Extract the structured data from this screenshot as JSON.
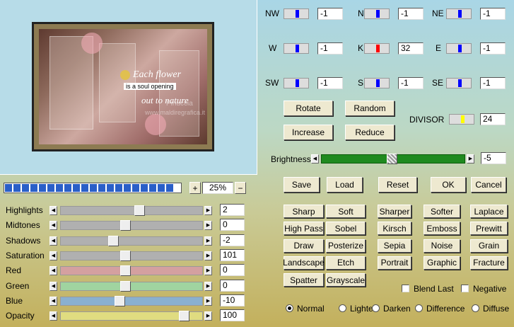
{
  "preview": {
    "text_line1": "Each flower",
    "text_line2": "is a soul opening",
    "text_line3": "out to nature",
    "watermark_line1": "Pinuccia",
    "watermark_line2": "www.maldiregrafica.it"
  },
  "zoom": {
    "plus": "+",
    "minus": "−",
    "value": "25%",
    "segments": 20
  },
  "grid": [
    {
      "label": "NW",
      "value": "-1",
      "color": "#0000ff"
    },
    {
      "label": "N",
      "value": "-1",
      "color": "#0000ff"
    },
    {
      "label": "NE",
      "value": "-1",
      "color": "#0000ff"
    },
    {
      "label": "W",
      "value": "-1",
      "color": "#0000ff"
    },
    {
      "label": "K",
      "value": "32",
      "color": "#ff0000"
    },
    {
      "label": "E",
      "value": "-1",
      "color": "#0000ff"
    },
    {
      "label": "SW",
      "value": "-1",
      "color": "#0000ff"
    },
    {
      "label": "S",
      "value": "-1",
      "color": "#0000ff"
    },
    {
      "label": "SE",
      "value": "-1",
      "color": "#0000ff"
    }
  ],
  "buttons": {
    "rotate": "Rotate",
    "random": "Random",
    "increase": "Increase",
    "reduce": "Reduce",
    "save": "Save",
    "load": "Load",
    "reset": "Reset",
    "ok": "OK",
    "cancel": "Cancel"
  },
  "divisor": {
    "label": "DIVISOR",
    "value": "24",
    "color": "#ffff00"
  },
  "brightness": {
    "label": "Brightness",
    "value": "-5",
    "level": 0.4
  },
  "adjust": [
    {
      "label": "Highlights",
      "value": "2",
      "track": "#b0b0b0",
      "pos": 0.56
    },
    {
      "label": "Midtones",
      "value": "0",
      "track": "#b0b0b0",
      "pos": 0.45
    },
    {
      "label": "Shadows",
      "value": "-2",
      "track": "#b0b0b0",
      "pos": 0.36
    },
    {
      "label": "Saturation",
      "value": "101",
      "track": "#b0b0b0",
      "pos": 0.45
    },
    {
      "label": "Red",
      "value": "0",
      "track": "#d4a0a0",
      "pos": 0.45
    },
    {
      "label": "Green",
      "value": "0",
      "track": "#a0d4a0",
      "pos": 0.45
    },
    {
      "label": "Blue",
      "value": "-10",
      "track": "#8ab0d0",
      "pos": 0.41
    },
    {
      "label": "Opacity",
      "value": "100",
      "track": "#e0dc80",
      "pos": 0.9
    }
  ],
  "presets": [
    [
      "Sharp",
      "Soft",
      "Sharper",
      "Softer",
      "Laplace"
    ],
    [
      "High Pass",
      "Sobel",
      "Kirsch",
      "Emboss",
      "Prewitt"
    ],
    [
      "Draw",
      "Posterize",
      "Sepia",
      "Noise",
      "Grain"
    ],
    [
      "Landscape",
      "Etch",
      "Portrait",
      "Graphic",
      "Fracture"
    ],
    [
      "Spatter",
      "Grayscale"
    ]
  ],
  "checks": {
    "blend_last": "Blend Last",
    "negative": "Negative"
  },
  "blend_modes": [
    "Normal",
    "Lighten",
    "Darken",
    "Difference",
    "Diffuse"
  ],
  "blend_selected": "Normal"
}
